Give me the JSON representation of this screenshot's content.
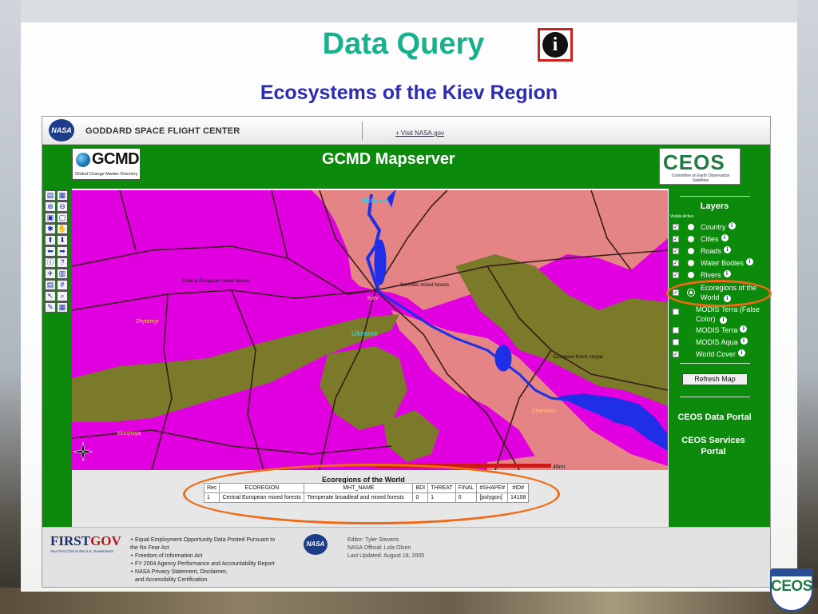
{
  "slide": {
    "title": "Data Query",
    "subtitle": "Ecosystems of the Kiev Region"
  },
  "nasa_bar": {
    "org": "GODDARD SPACE FLIGHT CENTER",
    "visit_link": "+ Visit NASA.gov",
    "logo_text": "NASA"
  },
  "header": {
    "title": "GCMD Mapserver",
    "gcmd_wordmark": "GCMD",
    "gcmd_tagline": "Global Change Master Directory",
    "ceos_wordmark": "CEOS",
    "ceos_tagline": "Committee on Earth Observation Satellites"
  },
  "toolbar": {
    "tools": [
      [
        "▤",
        "▦"
      ],
      [
        "⊕",
        "⊖"
      ],
      [
        "▣",
        "▢"
      ],
      [
        "✱",
        "✋"
      ],
      [
        "⬆",
        "⬇"
      ],
      [
        "⬅",
        "➡"
      ],
      [
        "ⓘ",
        "?"
      ],
      [
        "✈",
        "▥"
      ],
      [
        "▤",
        "#"
      ],
      [
        "↖",
        "⌕"
      ],
      [
        "✎",
        "▦"
      ]
    ]
  },
  "map": {
    "labels": {
      "belarus": "Belarus",
      "ukraine": "Ukraine",
      "kiev": "Kiev",
      "zhytomyr": "Zhytomyr",
      "vinnytsya": "Vinnytsya",
      "cherkasy": "Cherkasy",
      "central_forests": "Central European mixed forests",
      "sarmatic_forests": "Sarmatic mixed forests",
      "forest_steppe": "European forest steppe"
    },
    "scale_label": "46mi",
    "colors": {
      "mixed_forest": "#e000e0",
      "sarmatic": "#e58484",
      "steppe": "#7a7a2a",
      "water": "#1f2fe8",
      "roads": "#3a1a1a"
    }
  },
  "layers": {
    "title": "Layers",
    "visible_active_label": "Visible Active",
    "items": [
      {
        "name": "Country",
        "visible": true
      },
      {
        "name": "Cities",
        "visible": true
      },
      {
        "name": "Roads",
        "visible": true
      },
      {
        "name": "Water Bodies",
        "visible": true
      },
      {
        "name": "Rivers",
        "visible": true
      },
      {
        "name": "Ecoregions of the World",
        "visible": true,
        "active": true
      },
      {
        "name": "MODIS Terra (False Color)",
        "visible": false
      },
      {
        "name": "MODIS Terra",
        "visible": false
      },
      {
        "name": "MODIS Aqua",
        "visible": false
      },
      {
        "name": "World Cover",
        "visible": true
      }
    ],
    "refresh_label": "Refresh Map",
    "portal_data": "CEOS Data Portal",
    "portal_services": "CEOS Services Portal"
  },
  "results": {
    "title": "Ecoregions of the World",
    "columns": [
      "Rec",
      "ECOREGION",
      "MHT_NAME",
      "BDI",
      "THREAT",
      "FINAL",
      "#SHAPE#",
      "#ID#"
    ],
    "rows": [
      [
        "1",
        "Central European mixed forests",
        "Temperate broadleaf and mixed forests",
        "0",
        "1",
        "0",
        "[polygon]",
        "14108"
      ]
    ]
  },
  "footer": {
    "firstgov_first": "FIRST",
    "firstgov_gov": "GOV",
    "firstgov_tagline": "Your First Click to the U.S. Government",
    "links": [
      "+ Equal Employment Opportunity Data Posted Pursuant to",
      "the No Fear Act",
      "+ Freedom of Information Act",
      "+ FY 2004 Agency Performance and Accountability Report",
      "+ NASA Privacy Statement, Disclaimer,",
      "and Accessibility Certification"
    ],
    "editor": "Editor: Tyler Stevens",
    "official": "NASA Official: Lola Olsen",
    "updated": "Last Updated: August 18, 2005"
  },
  "corner_logo": {
    "word": "CEOS"
  }
}
